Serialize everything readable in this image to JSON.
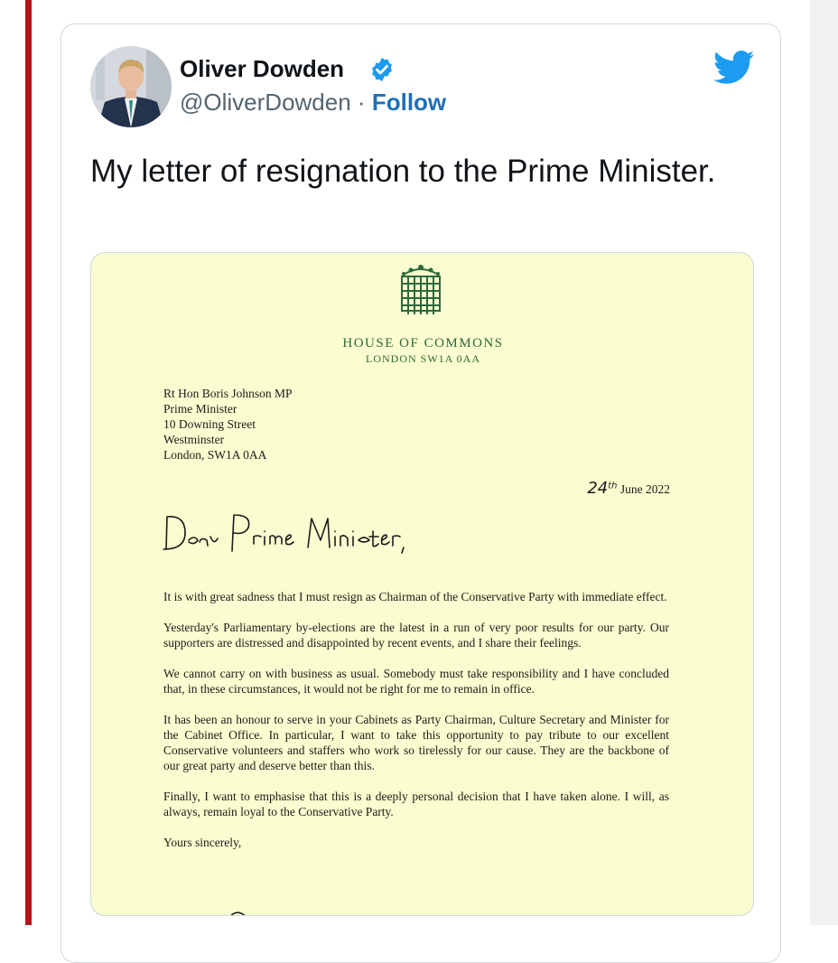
{
  "tweet": {
    "author_name": "Oliver Dowden",
    "handle": "@OliverDowden",
    "separator": "·",
    "follow_label": "Follow",
    "text": "My letter of resignation to the Prime Minister.",
    "icons": {
      "verified": "verified-badge-icon",
      "brand": "twitter-bird-icon"
    },
    "colors": {
      "link": "#1d6fb8",
      "verified": "#1d9bf0",
      "brand": "#1d9bf0",
      "left_bar": "#b4151a"
    }
  },
  "letter": {
    "header": {
      "title": "HOUSE OF COMMONS",
      "address": "LONDON SW1A 0AA"
    },
    "recipient": [
      "Rt Hon Boris Johnson MP",
      "Prime Minister",
      "10 Downing Street",
      "Westminster",
      "London, SW1A 0AA"
    ],
    "date_day": "24",
    "date_suffix": "th",
    "date_rest": "June 2022",
    "salutation": "Dear Prime Minister,",
    "paragraphs": [
      "It is with great sadness that I must resign as Chairman of the Conservative Party with immediate effect.",
      "Yesterday's Parliamentary by-elections are the latest in a run of very poor results for our party. Our supporters are distressed and disappointed by recent events, and I share their feelings.",
      "We cannot carry on with business as usual. Somebody must take responsibility and I have concluded that, in these circumstances, it would not be right for me to remain in office.",
      "It has been an honour to serve in your Cabinets as Party Chairman, Culture Secretary and Minister for the Cabinet Office. In particular, I want to take this opportunity to pay tribute to our excellent Conservative volunteers and staffers who work so tirelessly for our cause. They are the backbone of our great party and deserve better than this.",
      "Finally, I want to emphasise that this is a deeply personal decision that I have taken alone. I will, as always, remain loyal to the Conservative Party."
    ],
    "sign_off": "Yours sincerely,",
    "colors": {
      "paper": "#fbfccf",
      "crest": "#2c6a3d"
    }
  }
}
